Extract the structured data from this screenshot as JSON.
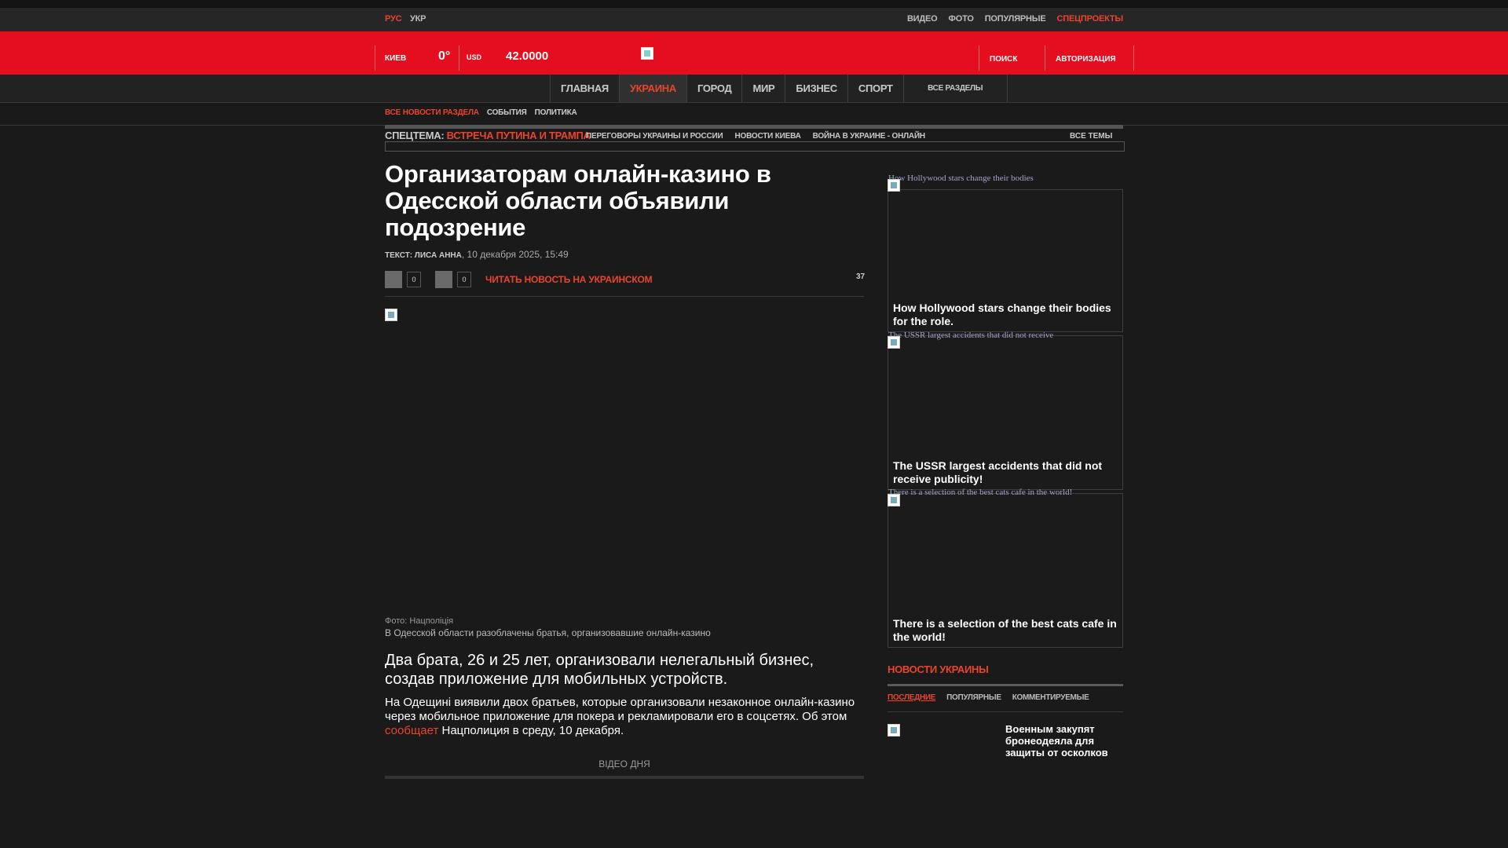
{
  "top": {
    "lang_rus": "РУС",
    "lang_ukr": "УКР",
    "links": [
      {
        "label": "ВИДЕО"
      },
      {
        "label": "ФОТО"
      },
      {
        "label": "ПОПУЛЯРНЫЕ"
      },
      {
        "label": "СПЕЦПРОЕКТЫ"
      }
    ]
  },
  "header": {
    "city": "КИЕВ",
    "temperature": "0°",
    "currency": "USD",
    "rate": "42.0000",
    "search": "ПОИСК",
    "auth": "АВТОРИЗАЦИЯ"
  },
  "nav": {
    "items": [
      {
        "label": "ГЛАВНАЯ"
      },
      {
        "label": "УКРАИНА"
      },
      {
        "label": "ГОРОД"
      },
      {
        "label": "МИР"
      },
      {
        "label": "БИЗНЕС"
      },
      {
        "label": "СПОРТ"
      }
    ],
    "all_sections": "ВСЕ РАЗДЕЛЫ"
  },
  "subnav": [
    "ВСЕ НОВОСТИ РАЗДЕЛА",
    "СОБЫТИЯ",
    "ПОЛИТИКА"
  ],
  "special": {
    "label": "СПЕЦТЕМА:",
    "topic": "ВСТРЕЧА ПУТИНА И ТРАМПА",
    "links": [
      "ПЕРЕГОВОРЫ УКРАИНЫ И РОССИИ",
      "НОВОСТИ КИЕВА",
      "ВОЙНА В УКРАИНЕ - ОНЛАЙН"
    ],
    "all_topics": "ВСЕ ТЕМЫ"
  },
  "article": {
    "title": "Организаторам онлайн-казино в Одесской области объявили подозрение",
    "author": "ТЕКСТ: ЛИСА АННА",
    "date": "10 декабря 2025, 15:49",
    "share_count_1": "0",
    "share_count_2": "0",
    "read_ua": "ЧИТАТЬ НОВОСТЬ НА УКРАИНСКОМ",
    "views": "37",
    "photo_credit": "Фото: Нацполіція",
    "photo_caption": "В Одесской области разоблачены братья, организовавшие онлайн-казино",
    "lead": "Два брата, 26 и 25 лет, организовали нелегальный бизнес, создав приложение для мобильных устройств.",
    "body_1": "На Одещині виявили двох братьев, которые организовали незаконное онлайн-казино через мобильное приложение для покера и рекламировали его в соцсетях. Об этом ",
    "body_link": "сообщает",
    "body_2": " Нацполиция в среду, 10 декабря.",
    "video_label": "ВІДЕО ДНЯ"
  },
  "cards": [
    {
      "alt": "How Hollywood stars change their bodies",
      "title": "How Hollywood stars change their bodies for the role."
    },
    {
      "alt": "The USSR largest accidents that did not receive",
      "title": "The USSR largest accidents that did not receive publicity!"
    },
    {
      "alt": "There is a selection of the best cats cafe in the world!",
      "title": "There is a selection of the best cats cafe in the world!"
    }
  ],
  "news": {
    "heading": "НОВОСТИ УКРАИНЫ",
    "tabs": [
      {
        "label": "ПОСЛЕДНИЕ"
      },
      {
        "label": "ПОПУЛЯРНЫЕ"
      },
      {
        "label": "КОММЕНТИРУЕМЫЕ"
      }
    ],
    "item_title": "Военным закупят бронеодеяла для защиты от осколков"
  },
  "colors": {
    "brand_red": "#e50e1e",
    "accent": "#e8442e",
    "background": "#1a1a1a"
  }
}
